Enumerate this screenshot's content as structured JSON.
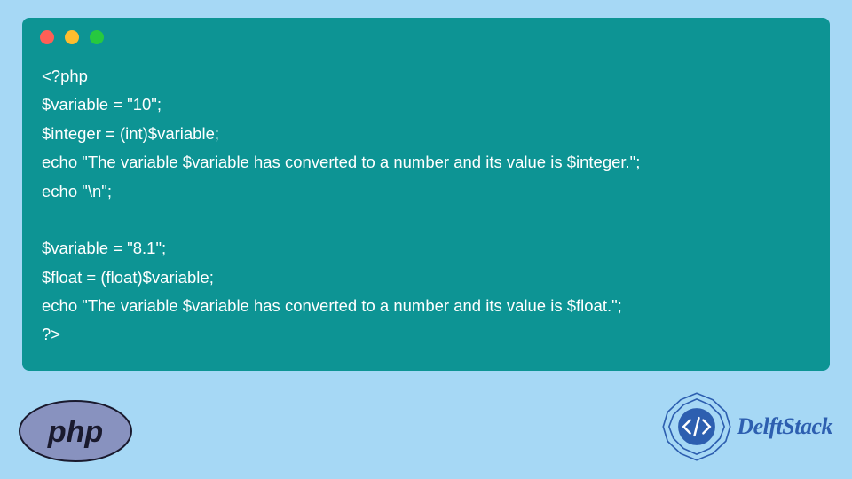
{
  "code": {
    "lines": [
      "<?php",
      "$variable = \"10\";",
      "$integer = (int)$variable;",
      "echo \"The variable $variable has converted to a number and its value is $integer.\";",
      "echo \"\\n\";",
      "",
      "$variable = \"8.1\";",
      "$float = (float)$variable;",
      "echo \"The variable $variable has converted to a number and its value is $float.\";",
      "?>"
    ]
  },
  "logos": {
    "php_text": "php",
    "delft_text": "DelftStack"
  },
  "colors": {
    "page_bg": "#a6d8f5",
    "code_bg": "#0d9494",
    "code_text": "#ffffff",
    "delft_blue": "#2d5fb0",
    "php_ellipse": "#8892bf"
  }
}
